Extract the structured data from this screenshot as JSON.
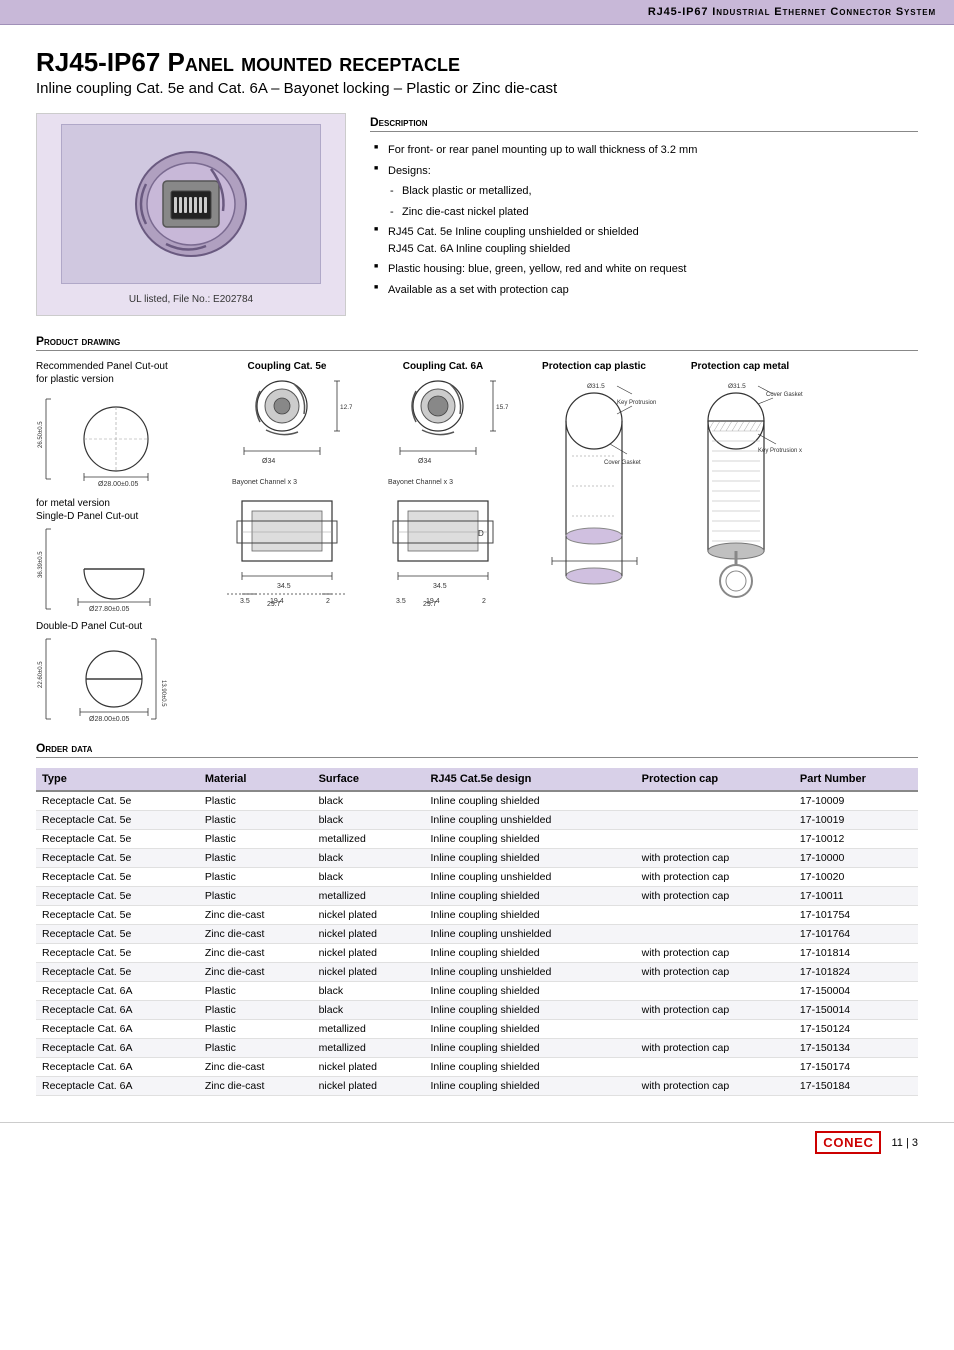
{
  "header": {
    "title": "RJ45-IP67 Industrial Ethernet Connector System"
  },
  "page": {
    "main_title": "RJ45-IP67 Panel mounted receptacle",
    "subtitle": "Inline coupling Cat. 5e and Cat. 6A – Bayonet locking – Plastic or Zinc die-cast"
  },
  "product_image": {
    "ul_label": "UL listed, File No.: E202784"
  },
  "description": {
    "title": "Description",
    "items": [
      "For front- or rear panel mounting up to wall thickness of 3.2 mm",
      "Designs:",
      "- Black plastic or metallized,",
      "- Zinc die-cast nickel plated",
      "RJ45 Cat. 5e Inline coupling unshielded or shielded",
      "RJ45 Cat. 6A Inline coupling shielded",
      "Plastic housing: blue, green, yellow, red and white on request",
      "Available as a set with protection cap"
    ]
  },
  "product_drawing": {
    "title": "Product drawing",
    "labels": {
      "panel_cutout": "Recommended Panel Cut-out",
      "plastic_version": "for plastic version",
      "metal_version": "for metal version",
      "single_d": "Single-D Panel Cut-out",
      "double_d": "Double-D Panel Cut-out",
      "coupling_5e": "Coupling Cat. 5e",
      "coupling_6a": "Coupling Cat. 6A",
      "protection_plastic": "Protection cap plastic",
      "protection_metal": "Protection cap metal",
      "bayonet_5e": "Bayonet Channel x 3",
      "bayonet_6a": "Bayonet Channel x 3"
    }
  },
  "order_data": {
    "title": "Order data",
    "columns": [
      "Type",
      "Material",
      "Surface",
      "RJ45 Cat.5e design",
      "Protection cap",
      "Part Number"
    ],
    "rows": [
      [
        "Receptacle Cat. 5e",
        "Plastic",
        "black",
        "Inline coupling shielded",
        "",
        "17-10009"
      ],
      [
        "Receptacle Cat. 5e",
        "Plastic",
        "black",
        "Inline coupling unshielded",
        "",
        "17-10019"
      ],
      [
        "Receptacle Cat. 5e",
        "Plastic",
        "metallized",
        "Inline coupling shielded",
        "",
        "17-10012"
      ],
      [
        "Receptacle Cat. 5e",
        "Plastic",
        "black",
        "Inline coupling shielded",
        "with protection cap",
        "17-10000"
      ],
      [
        "Receptacle Cat. 5e",
        "Plastic",
        "black",
        "Inline coupling unshielded",
        "with protection cap",
        "17-10020"
      ],
      [
        "Receptacle Cat. 5e",
        "Plastic",
        "metallized",
        "Inline coupling shielded",
        "with protection cap",
        "17-10011"
      ],
      [
        "Receptacle Cat. 5e",
        "Zinc die-cast",
        "nickel plated",
        "Inline coupling shielded",
        "",
        "17-101754"
      ],
      [
        "Receptacle Cat. 5e",
        "Zinc die-cast",
        "nickel plated",
        "Inline coupling unshielded",
        "",
        "17-101764"
      ],
      [
        "Receptacle Cat. 5e",
        "Zinc die-cast",
        "nickel plated",
        "Inline coupling shielded",
        "with protection cap",
        "17-101814"
      ],
      [
        "Receptacle Cat. 5e",
        "Zinc die-cast",
        "nickel plated",
        "Inline coupling unshielded",
        "with protection cap",
        "17-101824"
      ],
      [
        "Receptacle Cat. 6A",
        "Plastic",
        "black",
        "Inline coupling shielded",
        "",
        "17-150004"
      ],
      [
        "Receptacle Cat. 6A",
        "Plastic",
        "black",
        "Inline coupling shielded",
        "with protection cap",
        "17-150014"
      ],
      [
        "Receptacle Cat. 6A",
        "Plastic",
        "metallized",
        "Inline coupling shielded",
        "",
        "17-150124"
      ],
      [
        "Receptacle Cat. 6A",
        "Plastic",
        "metallized",
        "Inline coupling shielded",
        "with protection cap",
        "17-150134"
      ],
      [
        "Receptacle Cat. 6A",
        "Zinc die-cast",
        "nickel plated",
        "Inline coupling shielded",
        "",
        "17-150174"
      ],
      [
        "Receptacle Cat. 6A",
        "Zinc die-cast",
        "nickel plated",
        "Inline coupling shielded",
        "with protection cap",
        "17-150184"
      ]
    ]
  },
  "footer": {
    "logo": "CONEC",
    "page": "11 | 3"
  }
}
